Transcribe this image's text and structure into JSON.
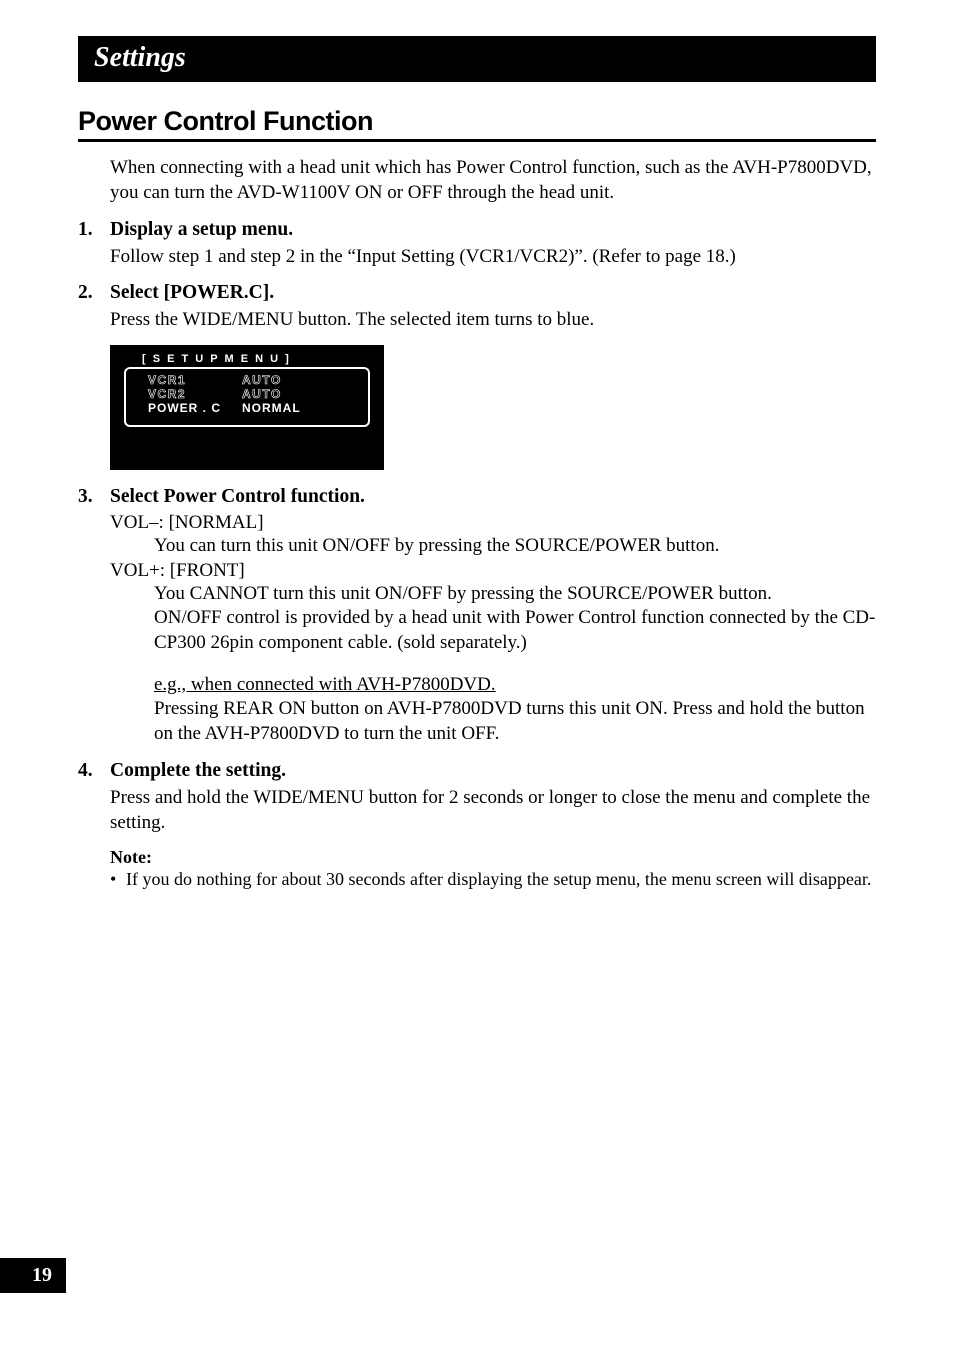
{
  "header": "Settings",
  "section_title": "Power Control Function",
  "intro": "When connecting with a head unit which has Power Control function, such as the AVH-P7800DVD, you can turn the AVD-W1100V ON or OFF through the head unit.",
  "steps": {
    "s1": {
      "num": "1.",
      "title": "Display a setup menu.",
      "body": "Follow step 1 and step 2 in the “Input Setting (VCR1/VCR2)”. (Refer to page 18.)"
    },
    "s2": {
      "num": "2.",
      "title": "Select [POWER.C].",
      "body": "Press the WIDE/MENU button. The selected item turns to blue."
    },
    "s3": {
      "num": "3.",
      "title": "Select Power Control function.",
      "vol_minus_label": "VOL–: [NORMAL]",
      "vol_minus_desc": "You can turn this unit ON/OFF by pressing the SOURCE/POWER button.",
      "vol_plus_label": "VOL+: [FRONT]",
      "vol_plus_desc1": "You CANNOT turn this unit ON/OFF by pressing the SOURCE/POWER button.",
      "vol_plus_desc2": "ON/OFF control is provided by a head unit with Power Control function connected by the CD-CP300 26pin component cable. (sold separately.)",
      "example_title": "e.g., when connected with AVH-P7800DVD.",
      "example_desc": "Pressing REAR ON button on AVH-P7800DVD turns this unit ON. Press and hold the button on the AVH-P7800DVD to turn the unit OFF."
    },
    "s4": {
      "num": "4.",
      "title": "Complete the setting.",
      "body": "Press and hold the WIDE/MENU button for 2 seconds or longer to close the menu and complete the setting."
    }
  },
  "setup_menu": {
    "title": "[ S E T U P  M E N U ]",
    "rows": [
      {
        "label": "VCR1",
        "value": "AUTO",
        "outlined": true
      },
      {
        "label": "VCR2",
        "value": "AUTO",
        "outlined": true
      },
      {
        "label": "POWER . C",
        "value": "NORMAL",
        "outlined": false
      }
    ]
  },
  "note": {
    "label": "Note:",
    "bullet": "•",
    "text": "If you do nothing for about 30 seconds after displaying the setup menu, the menu screen will disappear."
  },
  "page_number": "19"
}
